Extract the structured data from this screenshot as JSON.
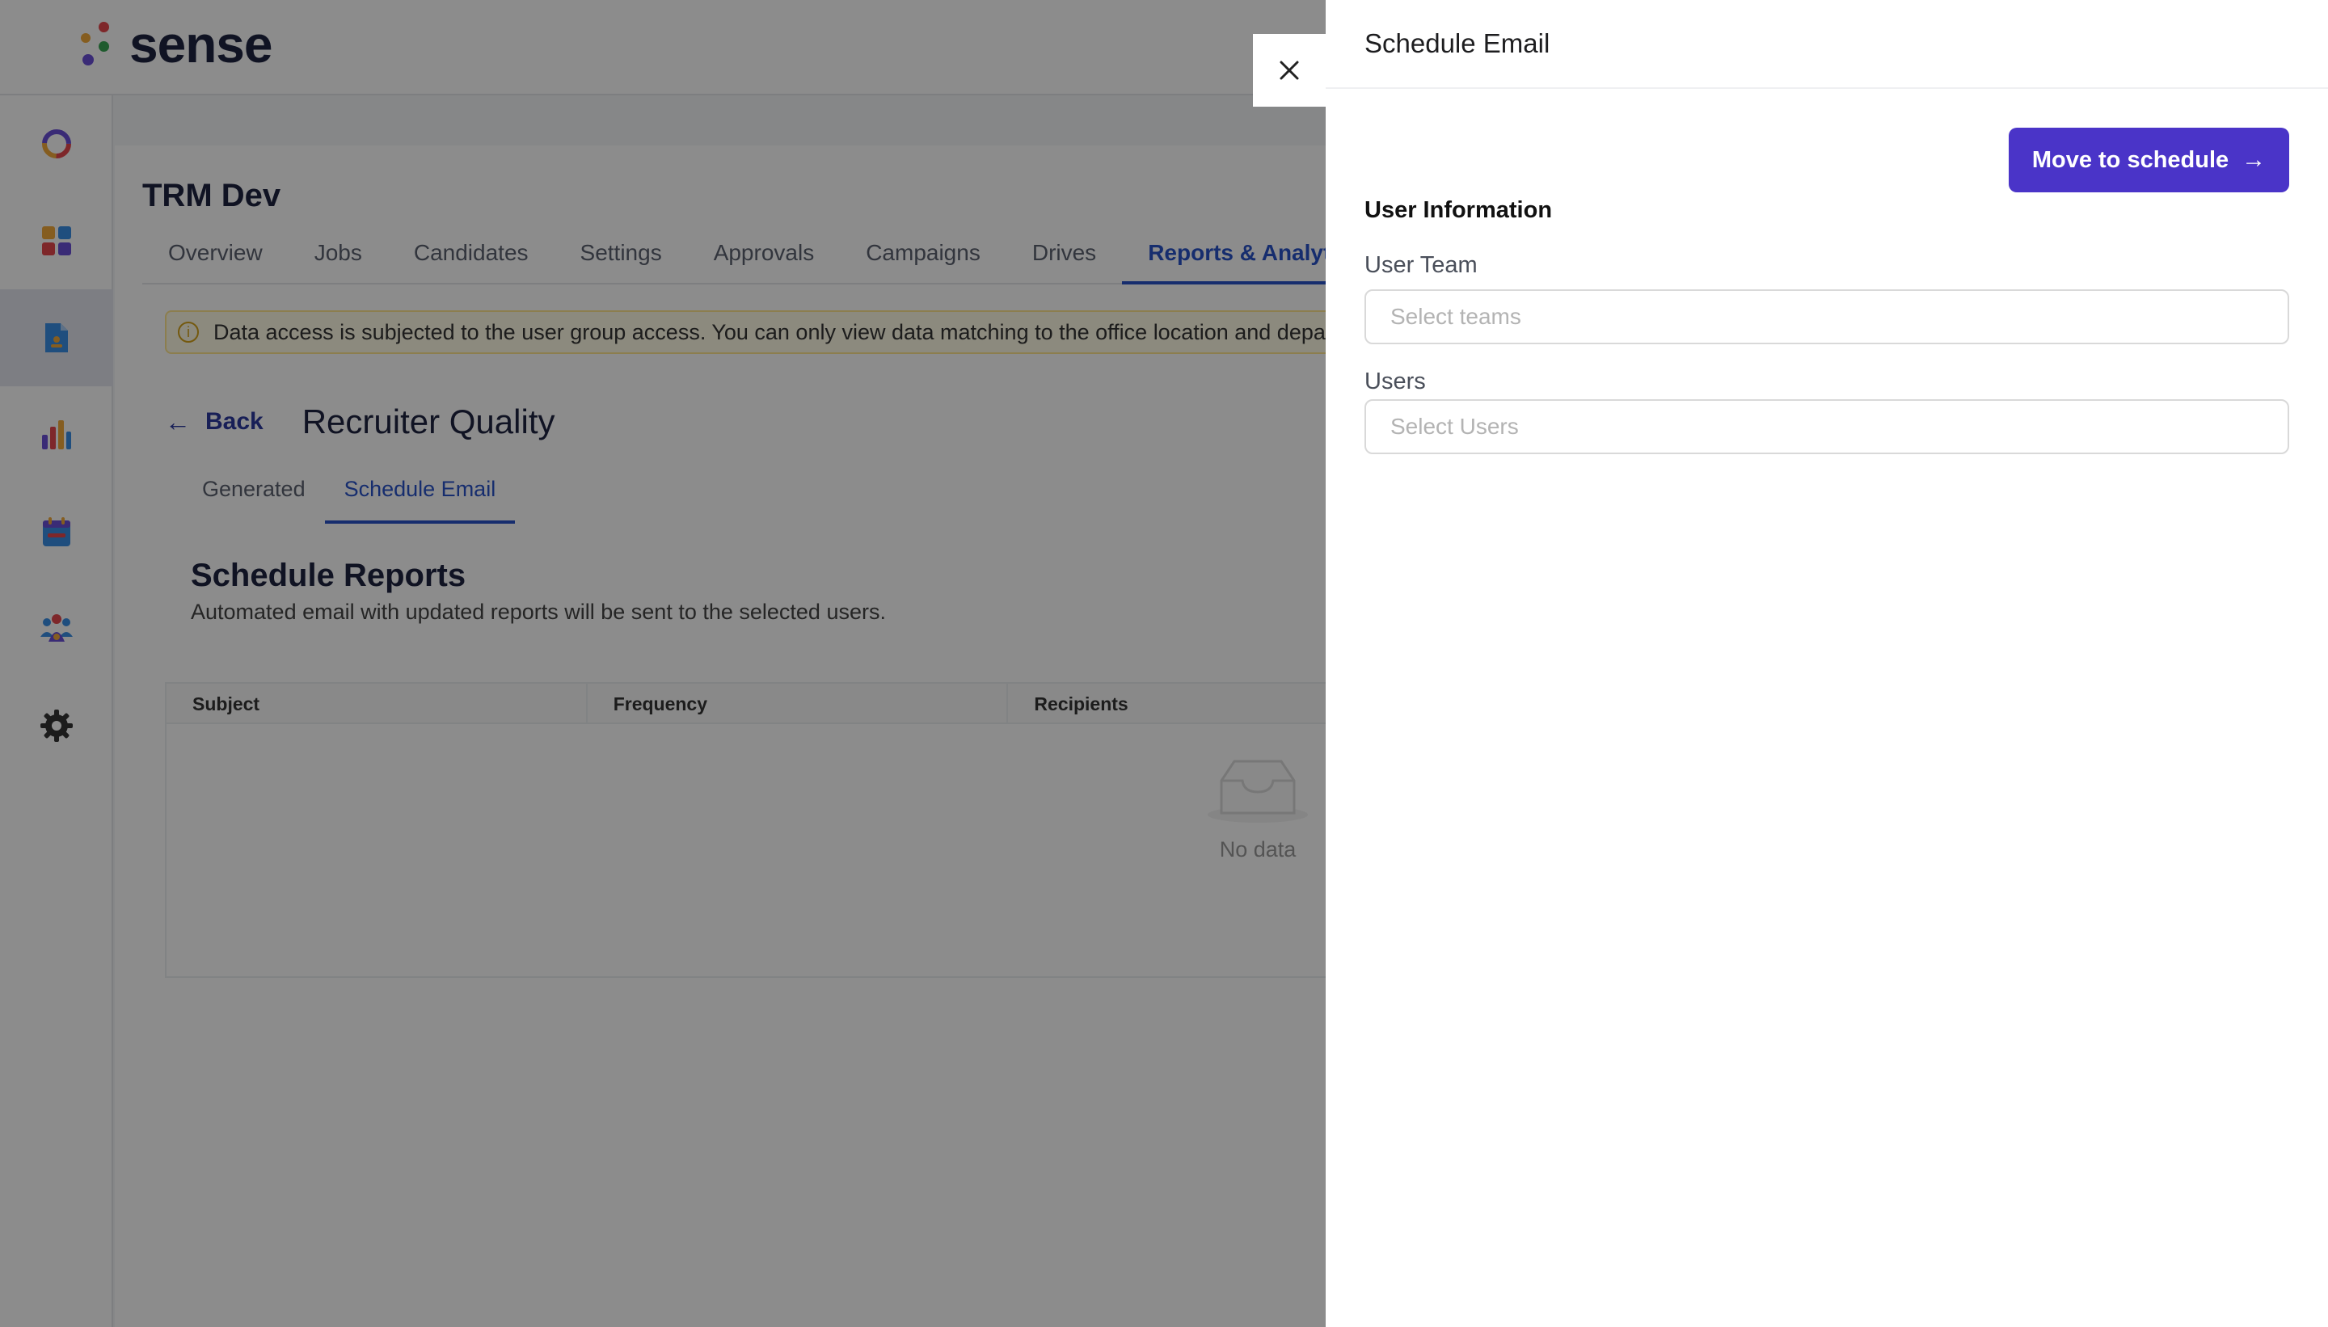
{
  "app": {
    "logo_text": "sense",
    "org_title": "TRM Dev",
    "tabs": [
      {
        "label": "Overview"
      },
      {
        "label": "Jobs"
      },
      {
        "label": "Candidates"
      },
      {
        "label": "Settings"
      },
      {
        "label": "Approvals"
      },
      {
        "label": "Campaigns"
      },
      {
        "label": "Drives"
      },
      {
        "label": "Reports & Analytics"
      }
    ],
    "active_tab": "Reports & Analytics",
    "alert_text": "Data access is subjected to the user group access. You can only view data matching to the office location and department of your user group.",
    "back_label": "Back",
    "report_title": "Recruiter Quality",
    "subtabs": [
      {
        "label": "Generated"
      },
      {
        "label": "Schedule Email"
      }
    ],
    "active_subtab": "Schedule Email",
    "section_title": "Schedule Reports",
    "section_subtitle": "Automated email with updated reports will be sent to the selected users.",
    "table": {
      "columns": [
        "Subject",
        "Frequency",
        "Recipients"
      ],
      "empty_text": "No data"
    },
    "sidebar_icons": [
      "analytics-ring-icon",
      "dashboard-grid-icon",
      "document-icon",
      "bar-chart-icon",
      "calendar-icon",
      "team-icon",
      "settings-gear-icon"
    ],
    "active_sidebar_icon": "document-icon"
  },
  "drawer": {
    "title": "Schedule Email",
    "move_button_label": "Move to schedule",
    "section_title": "User Information",
    "user_team": {
      "label": "User Team",
      "placeholder": "Select teams",
      "value": ""
    },
    "users": {
      "label": "Users",
      "placeholder": "Select Users",
      "value": ""
    }
  },
  "colors": {
    "primary_button": "#4a34c8",
    "active_tab": "#2952c8",
    "overlay": "rgba(0,0,0,0.45)"
  }
}
